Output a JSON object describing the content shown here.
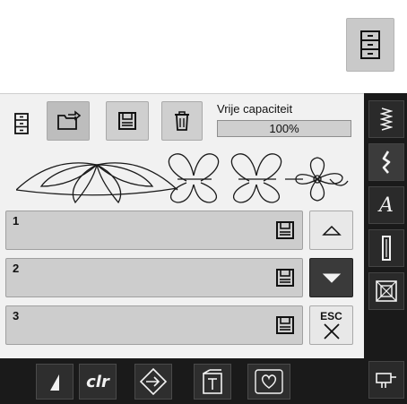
{
  "capacity": {
    "label": "Vrije capaciteit",
    "value_text": "100%",
    "fraction": 1.0
  },
  "slots": [
    {
      "number": "1"
    },
    {
      "number": "2"
    },
    {
      "number": "3"
    }
  ],
  "side_buttons": {
    "scroll_up": "up-arrow-icon",
    "scroll_down": "down-arrow-icon",
    "esc_label": "ESC"
  },
  "right_strip": [
    {
      "icon": "zigzag-stitch-icon"
    },
    {
      "icon": "decorative-stitch-icon"
    },
    {
      "icon": "alphabet-icon",
      "text": "A"
    },
    {
      "icon": "buttonhole-icon"
    },
    {
      "icon": "quilt-stitch-icon"
    },
    {
      "icon": "setup-program-icon"
    }
  ],
  "bottom_bar": {
    "clr_label": "clr",
    "icons": [
      "needle-stop-icon",
      "clear-icon",
      "stitch-direction-icon",
      "memory-tab-icon",
      "favorite-icon"
    ]
  },
  "colors": {
    "panel": "#f1f1f1",
    "dark_bar": "#1a1a1a",
    "button": "#cdcdcd"
  }
}
